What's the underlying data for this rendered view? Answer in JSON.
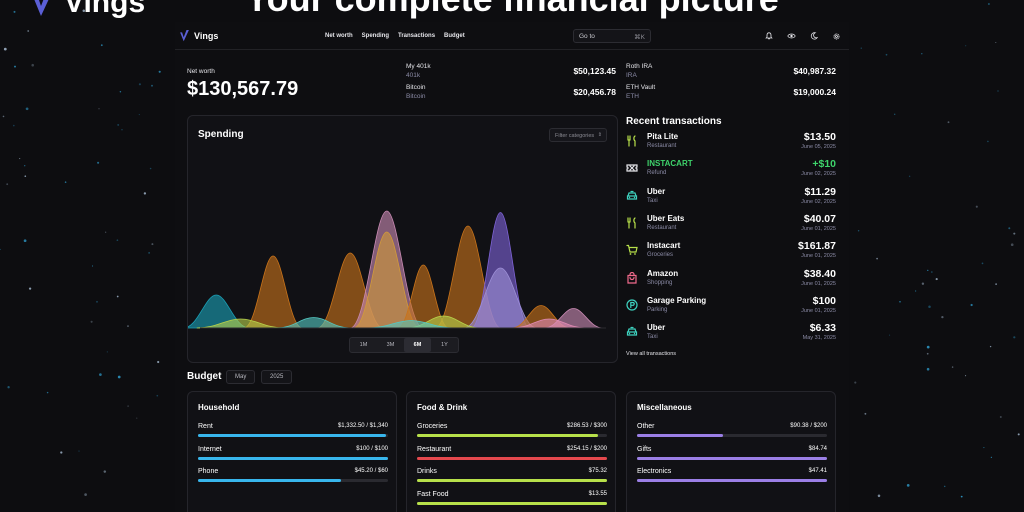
{
  "promo": {
    "brand": "Vings",
    "title": "Your complete financial picture"
  },
  "nav": {
    "brand": "Vings",
    "links": [
      "Net worth",
      "Spending",
      "Transactions",
      "Budget"
    ],
    "goto_placeholder": "Go to",
    "goto_shortcut": "⌘K",
    "icons": [
      "bell-icon",
      "eye-icon",
      "moon-icon",
      "gear-icon"
    ]
  },
  "net_worth": {
    "label": "Net worth",
    "value": "$130,567.79",
    "accounts": [
      {
        "name": "My 401k",
        "type": "401k",
        "value": "$50,123.45"
      },
      {
        "name": "Bitcoin",
        "type": "Bitcoin",
        "value": "$20,456.78"
      },
      {
        "name": "Roth IRA",
        "type": "IRA",
        "value": "$40,987.32"
      },
      {
        "name": "ETH Vault",
        "type": "ETH",
        "value": "$19,000.24"
      }
    ]
  },
  "spending": {
    "title": "Spending",
    "filter_placeholder": "Filter categories",
    "ranges": [
      "1M",
      "3M",
      "6M",
      "1Y"
    ],
    "active_range": "6M",
    "colors": [
      "#1a9fb5",
      "#c8731a",
      "#d19a3a",
      "#9d8fd6",
      "#7e63d6",
      "#c98ab3",
      "#b7d14a",
      "#54c7c0",
      "#e08ab3"
    ]
  },
  "transactions": {
    "title": "Recent transactions",
    "view_all": "View all transactions",
    "items": [
      {
        "name": "Pita Lite",
        "category": "Restaurant",
        "amount": "$13.50",
        "date": "June 05, 2025",
        "icon": "utensils-icon",
        "color": "#b7e04a",
        "name_color": "#ffffff",
        "amount_color": "#ffffff"
      },
      {
        "name": "INSTACART",
        "category": "Refund",
        "amount": "+$10",
        "date": "June 02, 2025",
        "icon": "ticket-icon",
        "color": "#e5e5ea",
        "name_color": "#3ed36b",
        "amount_color": "#3ed36b"
      },
      {
        "name": "Uber",
        "category": "Taxi",
        "amount": "$11.29",
        "date": "June 02, 2025",
        "icon": "taxi-icon",
        "color": "#3ed3c0",
        "name_color": "#ffffff",
        "amount_color": "#ffffff"
      },
      {
        "name": "Uber Eats",
        "category": "Restaurant",
        "amount": "$40.07",
        "date": "June 01, 2025",
        "icon": "utensils-icon",
        "color": "#b7e04a",
        "name_color": "#ffffff",
        "amount_color": "#ffffff"
      },
      {
        "name": "Instacart",
        "category": "Groceries",
        "amount": "$161.87",
        "date": "June 01, 2025",
        "icon": "cart-icon",
        "color": "#b7e04a",
        "name_color": "#ffffff",
        "amount_color": "#ffffff"
      },
      {
        "name": "Amazon",
        "category": "Shopping",
        "amount": "$38.40",
        "date": "June 01, 2025",
        "icon": "shopping-bag-icon",
        "color": "#f06a8c",
        "name_color": "#ffffff",
        "amount_color": "#ffffff"
      },
      {
        "name": "Garage Parking",
        "category": "Parking",
        "amount": "$100",
        "date": "June 01, 2025",
        "icon": "parking-icon",
        "color": "#3ed3c0",
        "name_color": "#ffffff",
        "amount_color": "#ffffff"
      },
      {
        "name": "Uber",
        "category": "Taxi",
        "amount": "$6.33",
        "date": "May 31, 2025",
        "icon": "taxi-icon",
        "color": "#3ed3c0",
        "name_color": "#ffffff",
        "amount_color": "#ffffff"
      }
    ]
  },
  "budget": {
    "title": "Budget",
    "month": "May",
    "year": "2025",
    "groups": [
      {
        "name": "Household",
        "items": [
          {
            "label": "Rent",
            "value": "$1,332.50 / $1,340",
            "progress": 0.99,
            "color": "#38b6ec"
          },
          {
            "label": "Internet",
            "value": "$100 / $100",
            "progress": 1.0,
            "color": "#38b6ec"
          },
          {
            "label": "Phone",
            "value": "$45.20 / $60",
            "progress": 0.75,
            "color": "#38b6ec"
          }
        ]
      },
      {
        "name": "Food & Drink",
        "items": [
          {
            "label": "Groceries",
            "value": "$286.53 / $300",
            "progress": 0.955,
            "color": "#b7e04a"
          },
          {
            "label": "Restaurant",
            "value": "$254.15 / $200",
            "progress": 1.0,
            "color": "#e5484d"
          },
          {
            "label": "Drinks",
            "value": "$75.32",
            "progress": 1.0,
            "color": "#b7e04a"
          },
          {
            "label": "Fast Food",
            "value": "$13.55",
            "progress": 1.0,
            "color": "#b7e04a"
          }
        ]
      },
      {
        "name": "Miscellaneous",
        "items": [
          {
            "label": "Other",
            "value": "$90.38 / $200",
            "progress": 0.45,
            "color": "#9b7fe6"
          },
          {
            "label": "Gifts",
            "value": "$84.74",
            "progress": 1.0,
            "color": "#9b7fe6"
          },
          {
            "label": "Electronics",
            "value": "$47.41",
            "progress": 1.0,
            "color": "#9b7fe6"
          }
        ]
      }
    ]
  }
}
